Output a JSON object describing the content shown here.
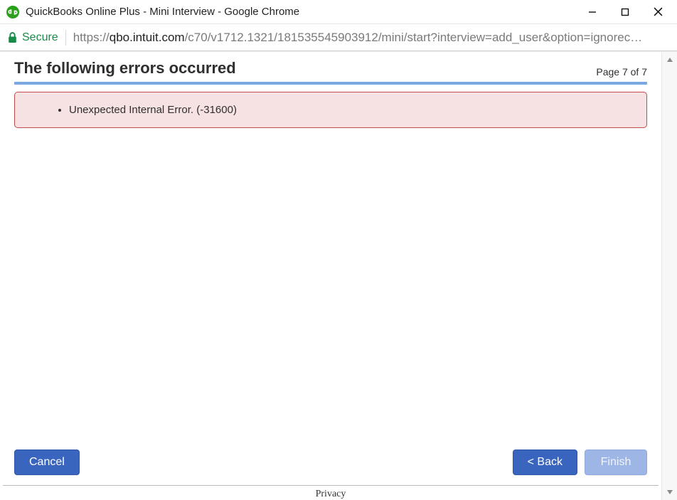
{
  "window": {
    "title": "QuickBooks Online Plus - Mini Interview - Google Chrome"
  },
  "addressbar": {
    "secure_label": "Secure",
    "scheme": "https",
    "host": "qbo.intuit.com",
    "path": "/c70/v1712.1321/181535545903912/mini/start?interview=add_user&option=ignorec…"
  },
  "page": {
    "title": "The following errors occurred",
    "indicator": "Page 7 of 7",
    "errors": [
      "Unexpected Internal Error. (-31600)"
    ]
  },
  "footer": {
    "cancel_label": "Cancel",
    "back_label": "< Back",
    "finish_label": "Finish",
    "privacy_label": "Privacy"
  }
}
